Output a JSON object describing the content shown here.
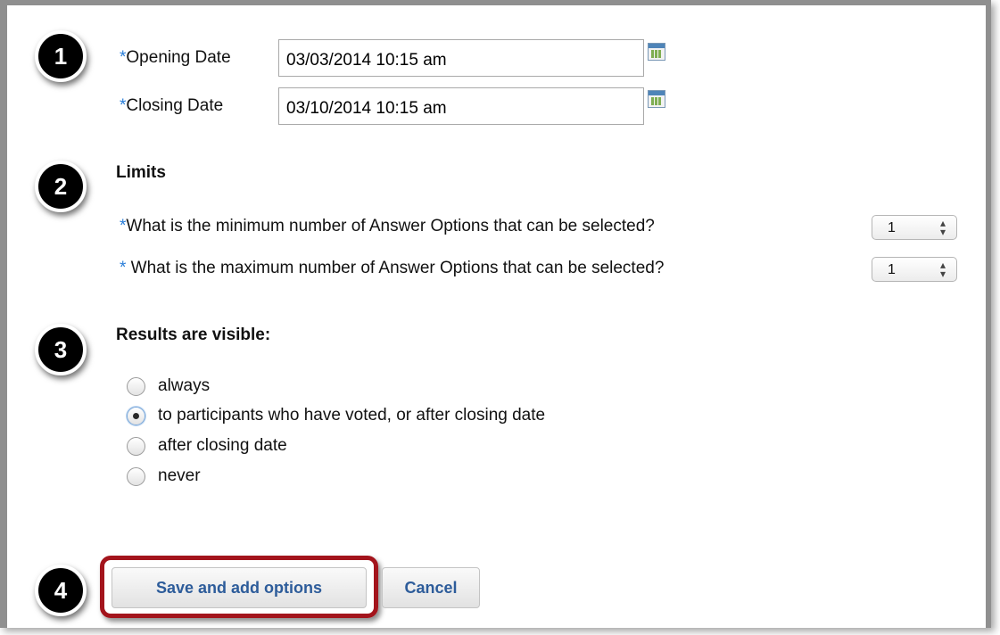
{
  "steps": [
    "1",
    "2",
    "3",
    "4"
  ],
  "dates": {
    "required_mark": "*",
    "opening_label": "Opening Date",
    "opening_value": "03/03/2014 10:15 am",
    "closing_label": "Closing Date",
    "closing_value": "03/10/2014 10:15 am"
  },
  "limits": {
    "heading": "Limits",
    "min_mark": "*",
    "min_question": "What is the minimum number of Answer Options that can be selected?",
    "min_value": "1",
    "max_mark": "*",
    "max_question": " What is the maximum number of Answer Options that can be selected?",
    "max_value": "1"
  },
  "results": {
    "heading": "Results are visible:",
    "options": [
      {
        "label": "always",
        "checked": false
      },
      {
        "label": "to participants who have voted, or after closing date",
        "checked": true
      },
      {
        "label": "after closing date",
        "checked": false
      },
      {
        "label": "never",
        "checked": false
      }
    ]
  },
  "actions": {
    "save_label": "Save and add options",
    "cancel_label": "Cancel",
    "highlight_color": "#a3141c"
  },
  "colors": {
    "required": "#2a7ed8",
    "button_text": "#2d5c9a"
  },
  "icons": {
    "calendar": "calendar-icon",
    "select_arrows": "updown-arrows-icon"
  }
}
